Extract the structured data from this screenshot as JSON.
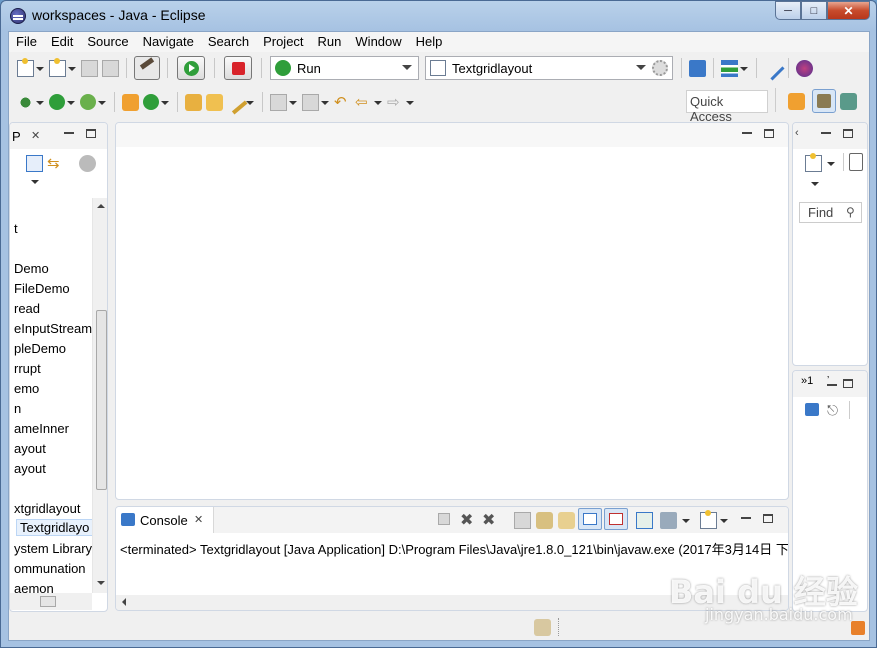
{
  "window": {
    "title": "workspaces - Java - Eclipse"
  },
  "menu": [
    "File",
    "Edit",
    "Source",
    "Navigate",
    "Search",
    "Project",
    "Run",
    "Window",
    "Help"
  ],
  "toolbar": {
    "run_combo": "Run",
    "launch_config": "Textgridlayout",
    "quick_access": "Quick Access"
  },
  "package_explorer": {
    "tab_title": "P",
    "items": [
      "t",
      "Demo",
      "FileDemo",
      "read",
      "eInputStream",
      "pleDemo",
      "rrupt",
      "emo",
      "n",
      "ameInner",
      "ayout",
      "ayout",
      "xtgridlayout",
      "Textgridlayo",
      "ystem Library",
      "ommunation",
      "aemon"
    ]
  },
  "outline": {
    "find_placeholder": "Find"
  },
  "small_panel": {
    "label": "»1"
  },
  "console": {
    "tab_title": "Console",
    "status_line": "<terminated> Textgridlayout [Java Application] D:\\Program Files\\Java\\jre1.8.0_121\\bin\\javaw.exe (2017年3月14日 下"
  },
  "watermark": {
    "brand": "Bai du 经验",
    "url": "jingyan.baidu.com"
  },
  "colors": {
    "titlebar": "#b9d1ea",
    "close_button": "#c74b2c",
    "run_green": "#2f9e3a",
    "stop_red": "#d8232a"
  }
}
